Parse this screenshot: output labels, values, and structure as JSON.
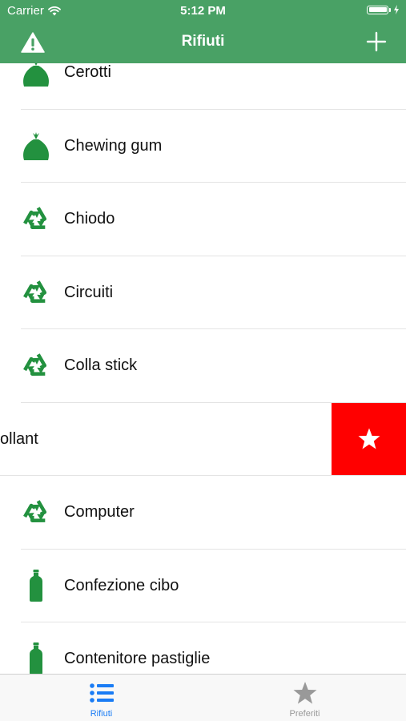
{
  "status_bar": {
    "carrier": "Carrier",
    "time": "5:12 PM"
  },
  "nav": {
    "title": "Rifiuti",
    "left_icon": "warning-icon",
    "right_icon": "plus-icon"
  },
  "colors": {
    "brand_green": "#49a165",
    "icon_green": "#23913f",
    "favorite_red": "#ff0000",
    "tab_active": "#1a7cf5",
    "tab_inactive": "#999999"
  },
  "items": [
    {
      "label": "Cerotti",
      "icon": "trash-bag-icon"
    },
    {
      "label": "Chewing gum",
      "icon": "trash-bag-icon"
    },
    {
      "label": "Chiodo",
      "icon": "recycle-icon"
    },
    {
      "label": "Circuiti",
      "icon": "recycle-icon"
    },
    {
      "label": "Colla stick",
      "icon": "recycle-icon"
    },
    {
      "label": "ollant",
      "icon": "none",
      "swiped": true,
      "action_icon": "star-icon"
    },
    {
      "label": "Computer",
      "icon": "recycle-icon"
    },
    {
      "label": "Confezione cibo",
      "icon": "bottle-icon"
    },
    {
      "label": "Contenitore pastiglie",
      "icon": "bottle-icon"
    }
  ],
  "tabs": [
    {
      "label": "Rifiuti",
      "icon": "list-icon",
      "active": true
    },
    {
      "label": "Preferiti",
      "icon": "star-icon",
      "active": false
    }
  ]
}
